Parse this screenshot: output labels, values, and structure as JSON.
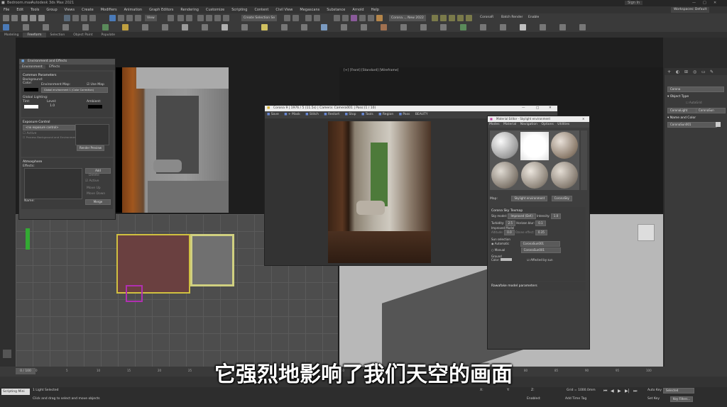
{
  "titlebar": {
    "file": "Bedroom.max",
    "app": "Autodesk 3ds Max 2021",
    "signin": "Sign In"
  },
  "menu": [
    "File",
    "Edit",
    "Tools",
    "Group",
    "Views",
    "Create",
    "Modifiers",
    "Animation",
    "Graph Editors",
    "Rendering",
    "Customize",
    "Scripting",
    "Content",
    "Civil View",
    "Megascans",
    "Substance",
    "Arnold",
    "Help"
  ],
  "toolbar": {
    "view_select": "View",
    "create_selection_set": "Create Selection Se",
    "workspace": "Workspaces: Default",
    "coronar": "CoronaR",
    "batch_render": "Batch Render",
    "enable": "Enable",
    "coord": "Corona..., New 2022"
  },
  "ribbon_tabs": [
    "Modeling",
    "Freeform",
    "Selection",
    "Object Paint",
    "Populate"
  ],
  "env_window": {
    "title": "Environment and Effects",
    "tabs": [
      "Environment",
      "Effects"
    ],
    "common_parameters": "Common Parameters",
    "background": "Background:",
    "color": "Color:",
    "env_map": "Environment Map:",
    "use_map": "Use Map",
    "map_name": "Global environment 1 (Color Correction)",
    "global_lighting": "Global Lighting:",
    "tint": "Tint:",
    "level": "Level:",
    "level_val": "1.0",
    "ambient": "Ambient:",
    "exposure_control": "Exposure Control",
    "exposure_type": "<no exposure control>",
    "active": "Active",
    "process_bg": "Process Background and Environment Maps",
    "render_preview": "Render Preview",
    "atmosphere": "Atmosphere",
    "effects": "Effects:",
    "add": "Add",
    "delete": "Delete",
    "active2": "Active",
    "move_up": "Move Up",
    "move_down": "Move Down",
    "name": "Name:",
    "merge": "Merge"
  },
  "viewports": {
    "top_left": "[+] [Camera001] [Standard] [Default Shading]",
    "top_right": "[+] [Front] [Standard] [Wireframe]",
    "bottom_left": "[+] [Top] [Standard] [Wireframe]",
    "bottom_right": "[+] [Perspective] [Standard] [Default Shading]"
  },
  "vfb": {
    "title": "Corona 9 | 1976 / 5 (11.5s) | Camera: Camera001 | Pass:(1 / 10)",
    "buttons": [
      "Save",
      "+ Mask",
      "Stitch",
      "Restart",
      "Stop",
      "Tools",
      "Region",
      "Pass",
      "BEAUTY"
    ]
  },
  "material_editor": {
    "title": "Material Editor - Skylight environment",
    "menu": [
      "Modes",
      "Material",
      "Navigation",
      "Options",
      "Utilities"
    ],
    "map_label": "Map:",
    "map_name": "Skylight environment",
    "map_type": "CoronaSky",
    "rollout": "Corona Sky Texmap",
    "sky_model": "Sky model:",
    "sky_model_val": "Improved (Def.)",
    "intensity": "Intensity:",
    "intensity_val": "1.0",
    "turbidity": "Turbidity:",
    "turbidity_val": "2.5",
    "horizon_blur": "Horizon blur:",
    "horizon_val": "0.1",
    "improved_model": "Improved Model",
    "altitude": "Altitude:",
    "altitude_val": "0.0",
    "ozone": "Ozone effect:",
    "ozone_val": "0.35",
    "sun_selection": "Sun selection",
    "automatic": "Automatic",
    "sun_auto": "CoronaSun001",
    "manual": "Manual",
    "sun_manual": "CoronaSun001",
    "ground": "Ground",
    "color": "Color:",
    "affected": "Affected by sun",
    "rawafake": "Rawafake model parameters"
  },
  "command_panel": {
    "category": "Corona",
    "object_type": "Object Type",
    "autogrid": "AutoGrid",
    "btn1": "CoronaLight",
    "btn2": "CoronaSun",
    "name_color": "Name and Color",
    "obj_name": "CoronaSun001"
  },
  "timeline": {
    "frame": "0 / 100",
    "ticks": [
      "0",
      "5",
      "10",
      "15",
      "20",
      "25",
      "30",
      "35",
      "40",
      "45",
      "50",
      "55",
      "60",
      "65",
      "70",
      "75",
      "80",
      "85",
      "90",
      "95",
      "100"
    ]
  },
  "status": {
    "maxscript": "Scripting Mini",
    "selected": "1 Light Selected",
    "prompt": "Click and drag to select and move objects",
    "x": "X:",
    "y": "Y:",
    "z": "Z:",
    "grid": "Grid = 1000.0mm",
    "enabled": "Enabled:",
    "add_time_tag": "Add Time Tag",
    "auto_key": "Auto Key",
    "selected_dd": "Selected",
    "set_key": "Set Key",
    "key_filters": "Key Filters..."
  },
  "subtitle": "它强烈地影响了我们天空的画面"
}
